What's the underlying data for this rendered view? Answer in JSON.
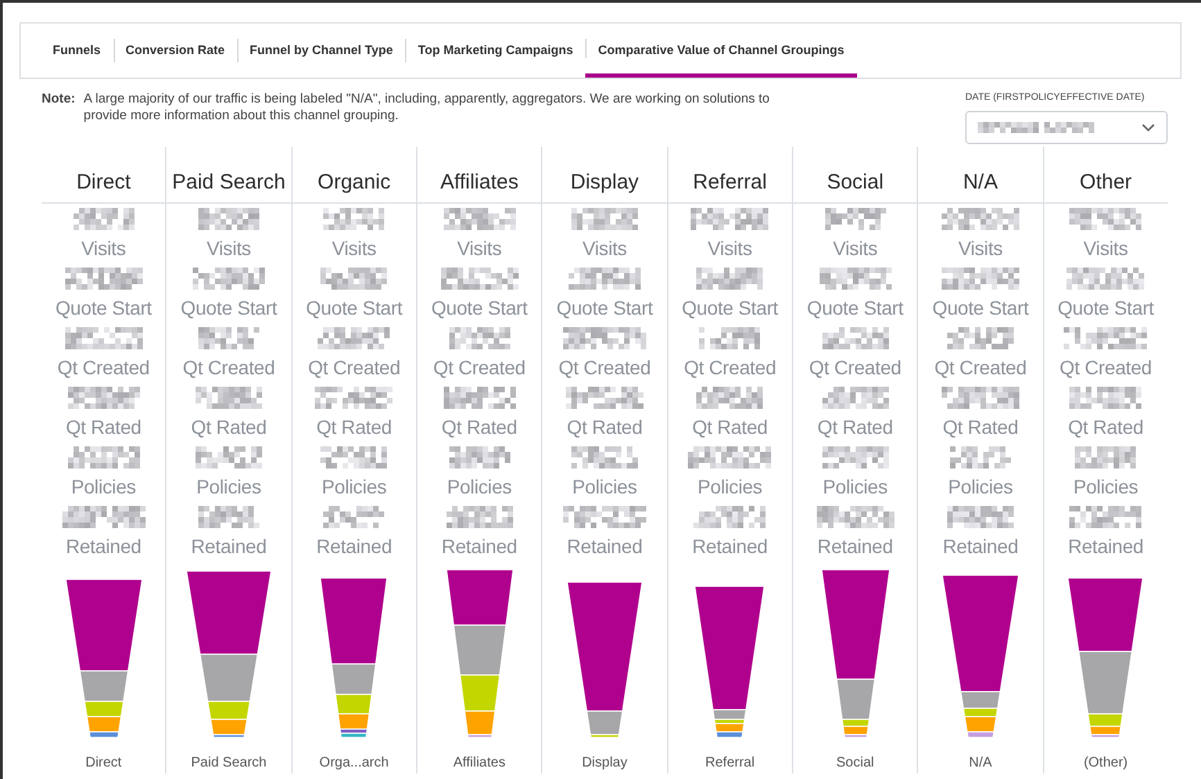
{
  "tabs": [
    {
      "label": "Funnels",
      "selected": false
    },
    {
      "label": "Conversion Rate",
      "selected": false
    },
    {
      "label": "Funnel by Channel Type",
      "selected": false
    },
    {
      "label": "Top Marketing Campaigns",
      "selected": false
    },
    {
      "label": "Comparative Value of Channel Groupings",
      "selected": true
    }
  ],
  "note": {
    "label": "Note:",
    "text": "A large majority of our traffic is being labeled \"N/A\", including, apparently, aggregators. We are working on solutions to provide more information about this channel grouping."
  },
  "date_filter": {
    "label": "DATE (FIRSTPOLICYEFFECTIVE DATE)"
  },
  "channels": [
    {
      "name": "Direct",
      "metrics": [
        "Visits",
        "Quote Start",
        "Qt Created",
        "Qt Rated",
        "Policies",
        "Retained"
      ],
      "funnel_label": "Direct"
    },
    {
      "name": "Paid Search",
      "metrics": [
        "Visits",
        "Quote Start",
        "Qt Created",
        "Qt Rated",
        "Policies",
        "Retained"
      ],
      "funnel_label": "Paid Search"
    },
    {
      "name": "Organic",
      "metrics": [
        "Visits",
        "Quote Start",
        "Qt Created",
        "Qt Rated",
        "Policies",
        "Retained"
      ],
      "funnel_label": "Orga...arch"
    },
    {
      "name": "Affiliates",
      "metrics": [
        "Visits",
        "Quote Start",
        "Qt Created",
        "Qt Rated",
        "Policies",
        "Retained"
      ],
      "funnel_label": "Affiliates"
    },
    {
      "name": "Display",
      "metrics": [
        "Visits",
        "Quote Start",
        "Qt Created",
        "Qt Rated",
        "Policies",
        "Retained"
      ],
      "funnel_label": "Display"
    },
    {
      "name": "Referral",
      "metrics": [
        "Visits",
        "Quote Start",
        "Qt Created",
        "Qt Rated",
        "Policies",
        "Retained"
      ],
      "funnel_label": "Referral"
    },
    {
      "name": "Social",
      "metrics": [
        "Visits",
        "Quote Start",
        "Qt Created",
        "Qt Rated",
        "Policies",
        "Retained"
      ],
      "funnel_label": "Social"
    },
    {
      "name": "N/A",
      "metrics": [
        "Visits",
        "Quote Start",
        "Qt Created",
        "Qt Rated",
        "Policies",
        "Retained"
      ],
      "funnel_label": "N/A"
    },
    {
      "name": "Other",
      "metrics": [
        "Visits",
        "Quote Start",
        "Qt Created",
        "Qt Rated",
        "Policies",
        "Retained"
      ],
      "funnel_label": "(Other)"
    }
  ]
}
